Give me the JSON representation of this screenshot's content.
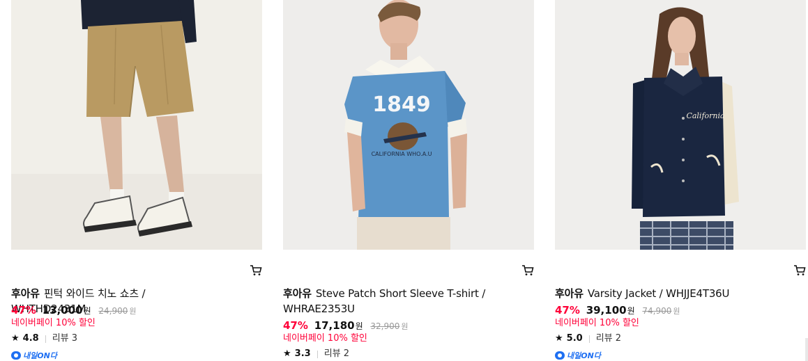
{
  "products": [
    {
      "brand": "후아유",
      "name": "핀턱 와이드 치노 쇼츠 / WHTHD2431M",
      "discount": "47%",
      "price": "13,000",
      "currency": "원",
      "original_price": "24,900",
      "naverpay": "네이버페이 10% 할인",
      "rating": "4.8",
      "reviews": "리뷰 3",
      "delivery_badge": "내일ON다",
      "image_icon": "chino-shorts-photo",
      "cart_icon": "cart-icon"
    },
    {
      "brand": "후아유",
      "name": "Steve Patch Short Sleeve T-shirt / WHRAE2353U",
      "discount": "47%",
      "price": "17,180",
      "currency": "원",
      "original_price": "32,900",
      "naverpay": "네이버페이 10% 할인",
      "rating": "3.3",
      "reviews": "리뷰 2",
      "image_icon": "tshirt-photo",
      "cart_icon": "cart-icon"
    },
    {
      "brand": "후아유",
      "name": "Varsity Jacket / WHJJE4T36U",
      "discount": "47%",
      "price": "39,100",
      "currency": "원",
      "original_price": "74,900",
      "naverpay": "네이버페이 10% 할인",
      "rating": "5.0",
      "reviews": "리뷰 2",
      "delivery_badge": "내일ON다",
      "image_icon": "varsity-jacket-photo",
      "cart_icon": "cart-icon"
    }
  ],
  "colors": {
    "discount": "#ff0038",
    "delivery": "#1e6ff2",
    "muted": "#999999"
  }
}
